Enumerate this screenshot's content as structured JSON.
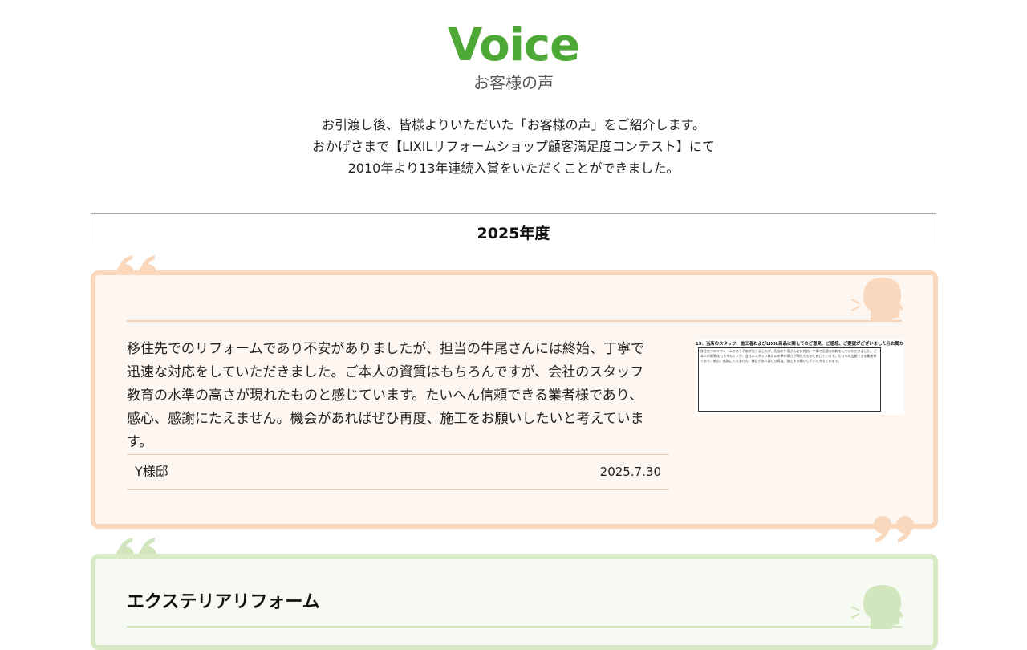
{
  "hero": {
    "title": "Voice",
    "subtitle": "お客様の声"
  },
  "intro": [
    "お引渡し後、皆様よりいただいた「お客様の声」をご紹介します。",
    "おかげさまで【LIXILリフォームショップ顧客満足度コンテスト】にて",
    "2010年より13年連続入賞をいただくことができました。"
  ],
  "year": "2025年度",
  "card1": {
    "body": [
      "移住先でのリフォームであり不安がありましたが、担当の牛尾さんには終始、丁寧で",
      "迅速な対応をしていただきました。ご本人の資質はもちろんですが、会社のスタッフ",
      "教育の水準の高さが現れたものと感じています。たいへん信頼できる業者様であり、",
      "感心、感謝にたえません。機会があればぜひ再度、施工をお願いしたいと考えていま",
      "す。"
    ],
    "name": "Y様邸",
    "date": "2025.7.30",
    "thumb": {
      "heading": "19．当店のスタッフ、施工者およびLIXIL商品に関してのご意見、ご感想、ご要望がございましたらお聞かせください。",
      "text": "移住先でのリフォームであり不安がありましたが、担当の牛尾さんには終始、丁寧で迅速な対応をしていただきました。ご本人の資質はもちろんですが、会社のスタッフ教育の水準の高さが現れたものと感じています。たいへん信頼できる業者様であり、感心、感謝にたえません。機会があればぜひ再度、施工をお願いしたいと考えています。"
    }
  },
  "card2": {
    "title": "エクステリアリフォーム"
  },
  "colors": {
    "brand_green": "#4ea836",
    "orange_border": "#f9d8bd",
    "green_border": "#d8e9c5"
  }
}
